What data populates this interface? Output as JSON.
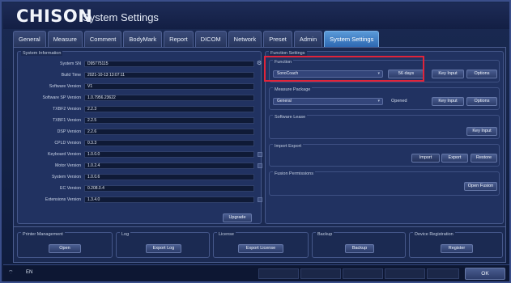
{
  "brand": "CHISON",
  "title": "System Settings",
  "tabs": [
    "General",
    "Measure",
    "Comment",
    "BodyMark",
    "Report",
    "DICOM",
    "Network",
    "Preset",
    "Admin",
    "System Settings"
  ],
  "system_information": {
    "title": "System Information",
    "rows": [
      {
        "label": "System SN",
        "value": "D95775115"
      },
      {
        "label": "Build Time",
        "value": "2021-10-13 13:07:11"
      },
      {
        "label": "Software Version",
        "value": "V1"
      },
      {
        "label": "Software SP Version",
        "value": "1.0.7956.23622"
      },
      {
        "label": "TXBF2 Version",
        "value": "2.2.3"
      },
      {
        "label": "TXBF1 Version",
        "value": "2.2.5"
      },
      {
        "label": "DSP Version",
        "value": "2.2.6"
      },
      {
        "label": "CPLD Version",
        "value": "0.3.3"
      },
      {
        "label": "Keyboard Version",
        "value": "1.0.0.0"
      },
      {
        "label": "Motor Version",
        "value": "1.0.2.4"
      },
      {
        "label": "System Version",
        "value": "1.0.0.6"
      },
      {
        "label": "EC Version",
        "value": "0.208.0.4"
      },
      {
        "label": "Extensions Version",
        "value": "1.3.4.0"
      }
    ],
    "upgrade_label": "Upgrade"
  },
  "function_settings": {
    "title": "Function Settings",
    "function": {
      "title": "Function",
      "selected": "SonoCoach",
      "days": "56 days",
      "key_input": "Key Input",
      "options": "Options"
    },
    "measure_package": {
      "title": "Measure Package",
      "selected": "General",
      "status": "Opened",
      "key_input": "Key Input",
      "options": "Options"
    },
    "software_lease": {
      "title": "Software Lease",
      "key_input": "Key Input"
    },
    "import_export": {
      "title": "Import Export",
      "import": "Import",
      "export": "Export",
      "restore": "Restore"
    },
    "fusion_permissions": {
      "title": "Fusion Permissions",
      "open_fusion": "Open Fusion"
    }
  },
  "bottom_panels": {
    "printer": {
      "title": "Printer Management",
      "button": "Open"
    },
    "log": {
      "title": "Log",
      "button": "Export Log"
    },
    "license": {
      "title": "License",
      "button": "Export License"
    },
    "backup": {
      "title": "Backup",
      "button": "Backup"
    },
    "device": {
      "title": "Device Registration",
      "button": "Register"
    }
  },
  "status": {
    "language": "EN",
    "ok": "OK"
  },
  "colors": {
    "highlight": "#e0243a",
    "active_tab": "#2d68b2"
  }
}
